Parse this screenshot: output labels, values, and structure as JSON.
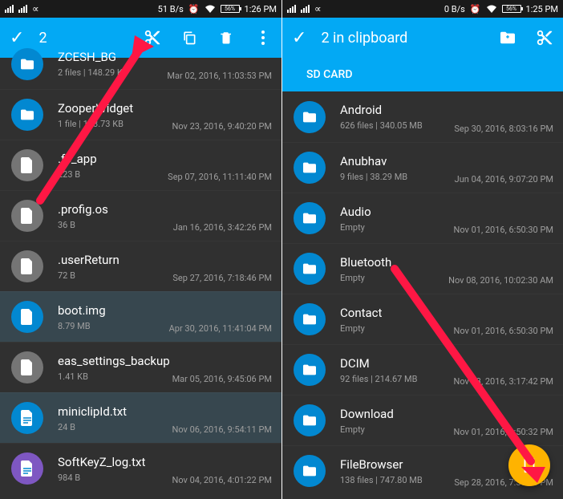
{
  "left": {
    "status": {
      "speed": "51 B/s",
      "batt": "56%",
      "time": "1:26 PM"
    },
    "action": {
      "count": "2"
    },
    "items": [
      {
        "name": "ZCESH_BG",
        "sub": "2 files | 148.29 KB",
        "date": "Mar 02, 2016, 11:03:53 PM",
        "avatar": "av-blue",
        "type": "folder",
        "selected": false
      },
      {
        "name": "ZooperWidget",
        "sub": "1 file | 123.73 KB",
        "date": "Nov 23, 2016, 9:40:20 PM",
        "avatar": "av-blue",
        "type": "folder",
        "selected": false
      },
      {
        "name": ".fc_app",
        "sub": "223 B",
        "date": "Sep 07, 2016, 11:11:40 PM",
        "avatar": "av-gray",
        "type": "file",
        "selected": false
      },
      {
        "name": ".profig.os",
        "sub": "36 B",
        "date": "Jan 16, 2016, 3:42:26 PM",
        "avatar": "av-gray",
        "type": "file",
        "selected": false
      },
      {
        "name": ".userReturn",
        "sub": "72 B",
        "date": "Sep 27, 2016, 7:18:46 PM",
        "avatar": "av-gray",
        "type": "file",
        "selected": false
      },
      {
        "name": "boot.img",
        "sub": "8.79 MB",
        "date": "Apr 30, 2016, 11:41:04 PM",
        "avatar": "av-blue",
        "type": "file",
        "selected": true
      },
      {
        "name": "eas_settings_backup",
        "sub": "1.41 KB",
        "date": "Mar 05, 2016, 9:45:06 PM",
        "avatar": "av-gray",
        "type": "file",
        "selected": false
      },
      {
        "name": "miniclipId.txt",
        "sub": "24 B",
        "date": "Nov 06, 2016, 9:54:11 PM",
        "avatar": "av-blue",
        "type": "text",
        "selected": true
      },
      {
        "name": "SoftKeyZ_log.txt",
        "sub": "984 B",
        "date": "Nov 04, 2016, 4:01:22 PM",
        "avatar": "av-purple",
        "type": "text",
        "selected": false
      }
    ]
  },
  "right": {
    "status": {
      "speed": "0 B/s",
      "batt": "56%",
      "time": "1:25 PM"
    },
    "action": {
      "title": "2 in clipboard"
    },
    "tab": "SD CARD",
    "items": [
      {
        "name": "Android",
        "sub": "626 files | 340.05 MB",
        "date": "Sep 30, 2016, 8:03:16 PM"
      },
      {
        "name": "Anubhav",
        "sub": "9 files | 38.29 MB",
        "date": "Jun 04, 2016, 9:07:20 PM"
      },
      {
        "name": "Audio",
        "sub": "Empty",
        "date": "Nov 01, 2016, 6:50:30 PM"
      },
      {
        "name": "Bluetooth",
        "sub": "Empty",
        "date": "Nov 08, 2016, 10:02:30 AM"
      },
      {
        "name": "Contact",
        "sub": "Empty",
        "date": "Nov 01, 2016, 6:50:30 PM"
      },
      {
        "name": "DCIM",
        "sub": "92 files | 214.67 MB",
        "date": "Nov 23, 2016, 3:17:42 PM"
      },
      {
        "name": "Download",
        "sub": "Empty",
        "date": "Nov 01, 2016, 6:50:32 PM"
      },
      {
        "name": "FileBrowser",
        "sub": "138 files | 747.80 MB",
        "date": "Sep 28, 2016, 7:30:26 PM"
      }
    ]
  }
}
